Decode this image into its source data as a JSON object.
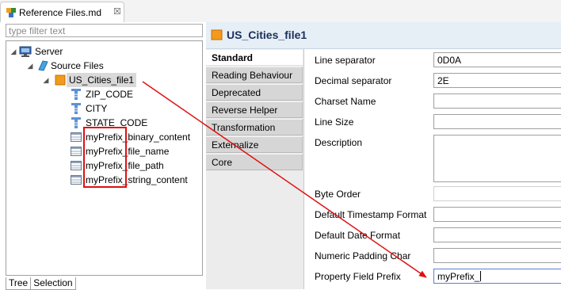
{
  "editor_tab": {
    "title": "Reference Files.md",
    "close_symbol": "☒"
  },
  "filter": {
    "placeholder": "type filter text",
    "value": ""
  },
  "tree": {
    "server": "Server",
    "source_files": "Source Files",
    "file": "US_Cities_file1",
    "columns": [
      "ZIP_CODE",
      "CITY",
      "STATE_CODE"
    ],
    "prefix_fields": [
      "myPrefix_binary_content",
      "myPrefix_file_name",
      "myPrefix_file_path",
      "myPrefix_string_content"
    ]
  },
  "bottom_tabs": [
    "Tree",
    "Selection"
  ],
  "properties": {
    "title": "US_Cities_file1",
    "tabs": [
      "Standard",
      "Reading Behaviour",
      "Deprecated",
      "Reverse Helper",
      "Transformation",
      "Externalize",
      "Core"
    ],
    "active_tab": "Standard",
    "fields": {
      "line_separator": {
        "label": "Line separator",
        "value": "0D0A"
      },
      "decimal_separator": {
        "label": "Decimal separator",
        "value": "2E"
      },
      "charset_name": {
        "label": "Charset Name",
        "value": ""
      },
      "line_size": {
        "label": "Line Size",
        "value": ""
      },
      "description": {
        "label": "Description",
        "value": ""
      },
      "byte_order": {
        "label": "Byte Order",
        "value": ""
      },
      "default_timestamp_format": {
        "label": "Default Timestamp Format",
        "value": ""
      },
      "default_date_format": {
        "label": "Default Date Format",
        "value": ""
      },
      "numeric_padding_char": {
        "label": "Numeric Padding Char",
        "value": ""
      },
      "property_field_prefix": {
        "label": "Property Field Prefix",
        "value": "myPrefix_"
      }
    }
  },
  "annotation": {
    "color": "#e01010"
  }
}
